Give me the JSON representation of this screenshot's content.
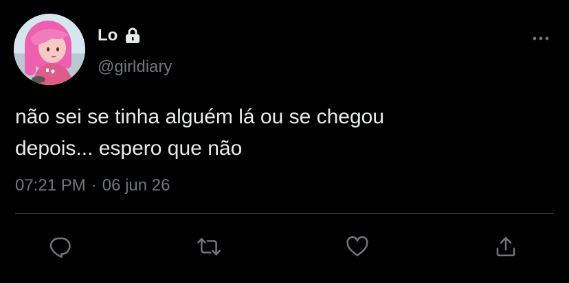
{
  "user": {
    "display_name": "Lo",
    "handle": "@girldiary",
    "protected_icon": "lock-icon",
    "avatar": "avatar"
  },
  "tweet": {
    "text": "não sei se tinha alguém lá ou se chegou\ndepois... espero que não",
    "time": "07:21 PM",
    "separator": "·",
    "date": "06 jun 26"
  },
  "actions": {
    "reply_icon": "reply-icon",
    "retweet_icon": "retweet-icon",
    "like_icon": "heart-icon",
    "share_icon": "share-icon"
  },
  "menu": {
    "more_icon": "more-icon"
  },
  "colors": {
    "background": "#000000",
    "primary_text": "#e7e9ea",
    "secondary_text": "#71767b",
    "divider": "#2f3336"
  }
}
